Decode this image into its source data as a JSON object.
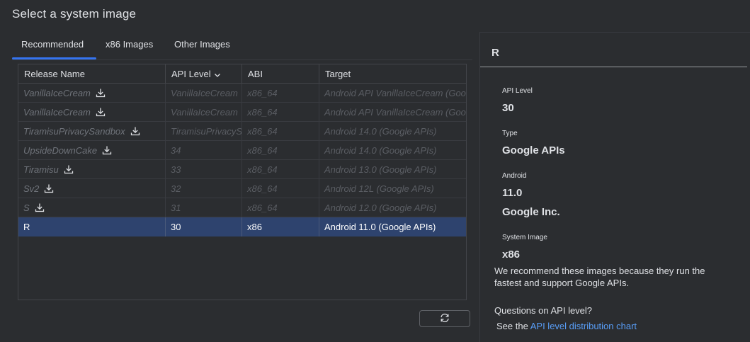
{
  "dialog": {
    "title": "Select a system image"
  },
  "tabs": [
    {
      "label": "Recommended"
    },
    {
      "label": "x86 Images"
    },
    {
      "label": "Other Images"
    }
  ],
  "table": {
    "columns": [
      "Release Name",
      "API Level",
      "ABI",
      "Target"
    ],
    "rows": [
      {
        "name": "VanillaIceCream",
        "api": "VanillaIceCream",
        "abi": "x86_64",
        "target": "Android API VanillaIceCream (Goo",
        "download": true
      },
      {
        "name": "VanillaIceCream",
        "api": "VanillaIceCream",
        "abi": "x86_64",
        "target": "Android API VanillaIceCream (Goo",
        "download": true
      },
      {
        "name": "TiramisuPrivacySandbox",
        "api": "TiramisuPrivacyS",
        "abi": "x86_64",
        "target": "Android 14.0 (Google APIs)",
        "download": true
      },
      {
        "name": "UpsideDownCake",
        "api": "34",
        "abi": "x86_64",
        "target": "Android 14.0 (Google APIs)",
        "download": true
      },
      {
        "name": "Tiramisu",
        "api": "33",
        "abi": "x86_64",
        "target": "Android 13.0 (Google APIs)",
        "download": true
      },
      {
        "name": "Sv2",
        "api": "32",
        "abi": "x86_64",
        "target": "Android 12L (Google APIs)",
        "download": true
      },
      {
        "name": "S",
        "api": "31",
        "abi": "x86_64",
        "target": "Android 12.0 (Google APIs)",
        "download": true
      },
      {
        "name": "R",
        "api": "30",
        "abi": "x86",
        "target": "Android 11.0 (Google APIs)",
        "download": false
      }
    ]
  },
  "details": {
    "title": "R",
    "api_level_label": "API Level",
    "api_level": "30",
    "type_label": "Type",
    "type": "Google APIs",
    "android_label": "Android",
    "android_version": "11.0",
    "vendor": "Google Inc.",
    "system_image_label": "System Image",
    "system_image": "x86",
    "recommend_line1": "We recommend these images because they run the",
    "recommend_line2": "fastest and support Google APIs.",
    "question": "Questions on API level?",
    "see_the": "See the",
    "link_text": "API level distribution chart"
  },
  "colors": {
    "accent": "#3574f0",
    "selected_row": "#2e436e",
    "link": "#589df6"
  }
}
